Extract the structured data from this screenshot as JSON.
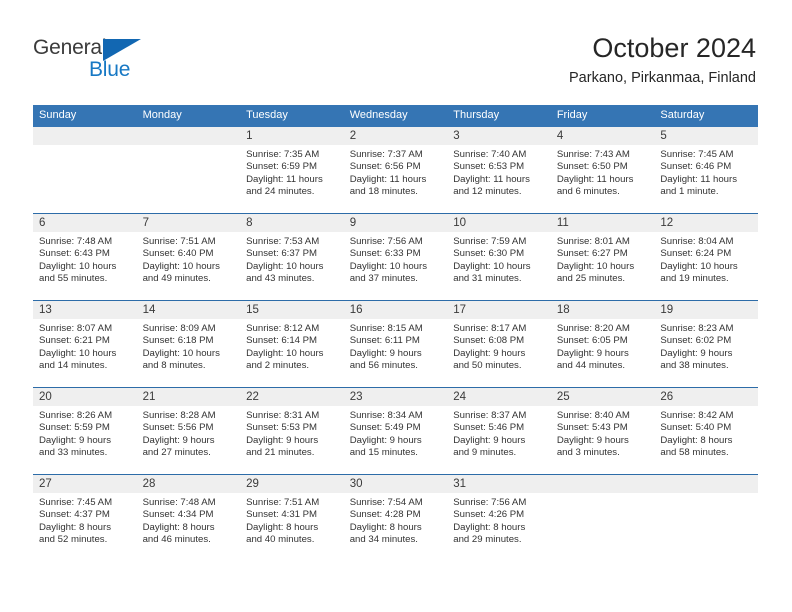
{
  "brand": {
    "name_top": "General",
    "name_bottom": "Blue",
    "triangle_icon": "blue-triangle-icon",
    "accent_color": "#1267b2"
  },
  "header": {
    "title": "October 2024",
    "location": "Parkano, Pirkanmaa, Finland"
  },
  "theme": {
    "header_blue": "#3575b4",
    "row_divider_blue": "#2d6ca8",
    "daynum_band_gray": "#efefef",
    "text_color": "#333333"
  },
  "weekday_headers": [
    "Sunday",
    "Monday",
    "Tuesday",
    "Wednesday",
    "Thursday",
    "Friday",
    "Saturday"
  ],
  "labels": {
    "sunrise_prefix": "Sunrise:",
    "sunset_prefix": "Sunset:",
    "daylight_prefix": "Daylight:"
  },
  "weeks": [
    [
      {
        "day": "",
        "blank": true
      },
      {
        "day": "",
        "blank": true
      },
      {
        "day": "1",
        "sunrise": "Sunrise: 7:35 AM",
        "sunset": "Sunset: 6:59 PM",
        "daylight_1": "Daylight: 11 hours",
        "daylight_2": "and 24 minutes."
      },
      {
        "day": "2",
        "sunrise": "Sunrise: 7:37 AM",
        "sunset": "Sunset: 6:56 PM",
        "daylight_1": "Daylight: 11 hours",
        "daylight_2": "and 18 minutes."
      },
      {
        "day": "3",
        "sunrise": "Sunrise: 7:40 AM",
        "sunset": "Sunset: 6:53 PM",
        "daylight_1": "Daylight: 11 hours",
        "daylight_2": "and 12 minutes."
      },
      {
        "day": "4",
        "sunrise": "Sunrise: 7:43 AM",
        "sunset": "Sunset: 6:50 PM",
        "daylight_1": "Daylight: 11 hours",
        "daylight_2": "and 6 minutes."
      },
      {
        "day": "5",
        "sunrise": "Sunrise: 7:45 AM",
        "sunset": "Sunset: 6:46 PM",
        "daylight_1": "Daylight: 11 hours",
        "daylight_2": "and 1 minute."
      }
    ],
    [
      {
        "day": "6",
        "sunrise": "Sunrise: 7:48 AM",
        "sunset": "Sunset: 6:43 PM",
        "daylight_1": "Daylight: 10 hours",
        "daylight_2": "and 55 minutes."
      },
      {
        "day": "7",
        "sunrise": "Sunrise: 7:51 AM",
        "sunset": "Sunset: 6:40 PM",
        "daylight_1": "Daylight: 10 hours",
        "daylight_2": "and 49 minutes."
      },
      {
        "day": "8",
        "sunrise": "Sunrise: 7:53 AM",
        "sunset": "Sunset: 6:37 PM",
        "daylight_1": "Daylight: 10 hours",
        "daylight_2": "and 43 minutes."
      },
      {
        "day": "9",
        "sunrise": "Sunrise: 7:56 AM",
        "sunset": "Sunset: 6:33 PM",
        "daylight_1": "Daylight: 10 hours",
        "daylight_2": "and 37 minutes."
      },
      {
        "day": "10",
        "sunrise": "Sunrise: 7:59 AM",
        "sunset": "Sunset: 6:30 PM",
        "daylight_1": "Daylight: 10 hours",
        "daylight_2": "and 31 minutes."
      },
      {
        "day": "11",
        "sunrise": "Sunrise: 8:01 AM",
        "sunset": "Sunset: 6:27 PM",
        "daylight_1": "Daylight: 10 hours",
        "daylight_2": "and 25 minutes."
      },
      {
        "day": "12",
        "sunrise": "Sunrise: 8:04 AM",
        "sunset": "Sunset: 6:24 PM",
        "daylight_1": "Daylight: 10 hours",
        "daylight_2": "and 19 minutes."
      }
    ],
    [
      {
        "day": "13",
        "sunrise": "Sunrise: 8:07 AM",
        "sunset": "Sunset: 6:21 PM",
        "daylight_1": "Daylight: 10 hours",
        "daylight_2": "and 14 minutes."
      },
      {
        "day": "14",
        "sunrise": "Sunrise: 8:09 AM",
        "sunset": "Sunset: 6:18 PM",
        "daylight_1": "Daylight: 10 hours",
        "daylight_2": "and 8 minutes."
      },
      {
        "day": "15",
        "sunrise": "Sunrise: 8:12 AM",
        "sunset": "Sunset: 6:14 PM",
        "daylight_1": "Daylight: 10 hours",
        "daylight_2": "and 2 minutes."
      },
      {
        "day": "16",
        "sunrise": "Sunrise: 8:15 AM",
        "sunset": "Sunset: 6:11 PM",
        "daylight_1": "Daylight: 9 hours",
        "daylight_2": "and 56 minutes."
      },
      {
        "day": "17",
        "sunrise": "Sunrise: 8:17 AM",
        "sunset": "Sunset: 6:08 PM",
        "daylight_1": "Daylight: 9 hours",
        "daylight_2": "and 50 minutes."
      },
      {
        "day": "18",
        "sunrise": "Sunrise: 8:20 AM",
        "sunset": "Sunset: 6:05 PM",
        "daylight_1": "Daylight: 9 hours",
        "daylight_2": "and 44 minutes."
      },
      {
        "day": "19",
        "sunrise": "Sunrise: 8:23 AM",
        "sunset": "Sunset: 6:02 PM",
        "daylight_1": "Daylight: 9 hours",
        "daylight_2": "and 38 minutes."
      }
    ],
    [
      {
        "day": "20",
        "sunrise": "Sunrise: 8:26 AM",
        "sunset": "Sunset: 5:59 PM",
        "daylight_1": "Daylight: 9 hours",
        "daylight_2": "and 33 minutes."
      },
      {
        "day": "21",
        "sunrise": "Sunrise: 8:28 AM",
        "sunset": "Sunset: 5:56 PM",
        "daylight_1": "Daylight: 9 hours",
        "daylight_2": "and 27 minutes."
      },
      {
        "day": "22",
        "sunrise": "Sunrise: 8:31 AM",
        "sunset": "Sunset: 5:53 PM",
        "daylight_1": "Daylight: 9 hours",
        "daylight_2": "and 21 minutes."
      },
      {
        "day": "23",
        "sunrise": "Sunrise: 8:34 AM",
        "sunset": "Sunset: 5:49 PM",
        "daylight_1": "Daylight: 9 hours",
        "daylight_2": "and 15 minutes."
      },
      {
        "day": "24",
        "sunrise": "Sunrise: 8:37 AM",
        "sunset": "Sunset: 5:46 PM",
        "daylight_1": "Daylight: 9 hours",
        "daylight_2": "and 9 minutes."
      },
      {
        "day": "25",
        "sunrise": "Sunrise: 8:40 AM",
        "sunset": "Sunset: 5:43 PM",
        "daylight_1": "Daylight: 9 hours",
        "daylight_2": "and 3 minutes."
      },
      {
        "day": "26",
        "sunrise": "Sunrise: 8:42 AM",
        "sunset": "Sunset: 5:40 PM",
        "daylight_1": "Daylight: 8 hours",
        "daylight_2": "and 58 minutes."
      }
    ],
    [
      {
        "day": "27",
        "sunrise": "Sunrise: 7:45 AM",
        "sunset": "Sunset: 4:37 PM",
        "daylight_1": "Daylight: 8 hours",
        "daylight_2": "and 52 minutes."
      },
      {
        "day": "28",
        "sunrise": "Sunrise: 7:48 AM",
        "sunset": "Sunset: 4:34 PM",
        "daylight_1": "Daylight: 8 hours",
        "daylight_2": "and 46 minutes."
      },
      {
        "day": "29",
        "sunrise": "Sunrise: 7:51 AM",
        "sunset": "Sunset: 4:31 PM",
        "daylight_1": "Daylight: 8 hours",
        "daylight_2": "and 40 minutes."
      },
      {
        "day": "30",
        "sunrise": "Sunrise: 7:54 AM",
        "sunset": "Sunset: 4:28 PM",
        "daylight_1": "Daylight: 8 hours",
        "daylight_2": "and 34 minutes."
      },
      {
        "day": "31",
        "sunrise": "Sunrise: 7:56 AM",
        "sunset": "Sunset: 4:26 PM",
        "daylight_1": "Daylight: 8 hours",
        "daylight_2": "and 29 minutes."
      },
      {
        "day": "",
        "blank": true
      },
      {
        "day": "",
        "blank": true
      }
    ]
  ]
}
